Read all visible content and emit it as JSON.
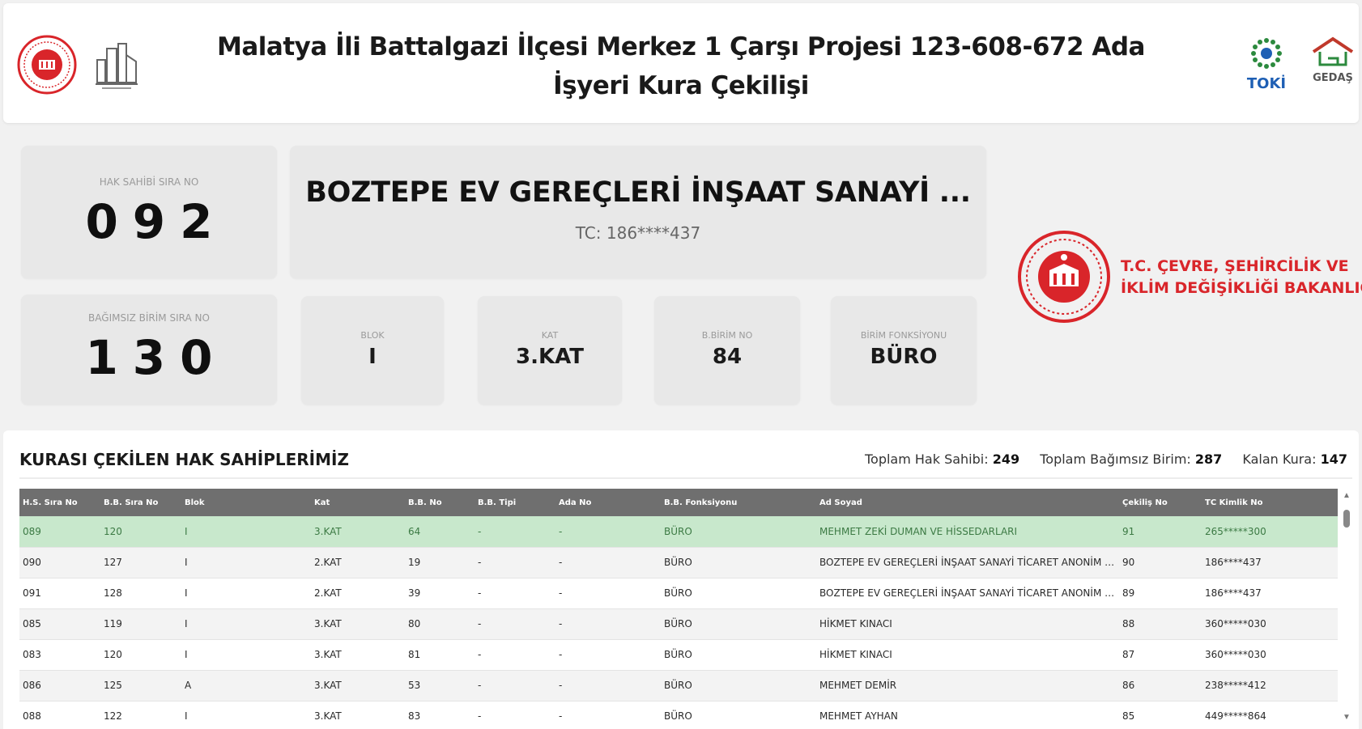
{
  "header": {
    "title": "Malatya İli Battalgazi İlçesi Merkez 1 Çarşı Projesi 123-608-672 Ada İşyeri Kura Çekilişi",
    "logo_left_1": "seal-icon",
    "logo_left_2": "building-logo-icon",
    "logo_right_1_text": "TOKİ",
    "logo_right_2_text": "GEDAŞ"
  },
  "hak_sahibi": {
    "label": "HAK SAHİBİ SIRA NO",
    "value": "092"
  },
  "bagimsiz_birim": {
    "label": "BAĞIMSIZ BİRİM SIRA NO",
    "value": "130"
  },
  "winner": {
    "name": "BOZTEPE EV GEREÇLERİ İNŞAAT SANAYİ ...",
    "tc": "TC: 186****437"
  },
  "details": [
    {
      "label": "BLOK",
      "value": "I"
    },
    {
      "label": "KAT",
      "value": "3.KAT"
    },
    {
      "label": "B.BİRİM NO",
      "value": "84"
    },
    {
      "label": "BİRİM FONKSİYONU",
      "value": "BÜRO"
    }
  ],
  "ministry": {
    "line1": "T.C. ÇEVRE, ŞEHİRCİLİK VE",
    "line2": "İKLİM DEĞİŞİKLİĞİ BAKANLIĞ"
  },
  "table_section": {
    "title": "KURASI ÇEKİLEN HAK SAHİPLERİMİZ",
    "stat1_label": "Toplam Hak Sahibi:",
    "stat1_value": "249",
    "stat2_label": "Toplam Bağımsız Birim:",
    "stat2_value": "287",
    "stat3_label": "Kalan Kura:",
    "stat3_value": "147"
  },
  "table": {
    "headers": [
      "H.S. Sıra No",
      "B.B. Sıra No",
      "Blok",
      "Kat",
      "B.B. No",
      "B.B. Tipi",
      "Ada No",
      "B.B. Fonksiyonu",
      "Ad Soyad",
      "Çekiliş No",
      "TC Kimlik No"
    ],
    "rows": [
      [
        "089",
        "120",
        "I",
        "3.KAT",
        "64",
        "-",
        "-",
        "BÜRO",
        "MEHMET ZEKİ DUMAN VE HİSSEDARLARI",
        "91",
        "265*****300"
      ],
      [
        "090",
        "127",
        "I",
        "2.KAT",
        "19",
        "-",
        "-",
        "BÜRO",
        "BOZTEPE EV GEREÇLERİ İNŞAAT SANAYİ TİCARET ANONİM Şİ...",
        "90",
        "186****437"
      ],
      [
        "091",
        "128",
        "I",
        "2.KAT",
        "39",
        "-",
        "-",
        "BÜRO",
        "BOZTEPE EV GEREÇLERİ İNŞAAT SANAYİ TİCARET ANONİM Şİ...",
        "89",
        "186****437"
      ],
      [
        "085",
        "119",
        "I",
        "3.KAT",
        "80",
        "-",
        "-",
        "BÜRO",
        "HİKMET KINACI",
        "88",
        "360*****030"
      ],
      [
        "083",
        "120",
        "I",
        "3.KAT",
        "81",
        "-",
        "-",
        "BÜRO",
        "HİKMET KINACI",
        "87",
        "360*****030"
      ],
      [
        "086",
        "125",
        "A",
        "3.KAT",
        "53",
        "-",
        "-",
        "BÜRO",
        "MEHMET DEMİR",
        "86",
        "238*****412"
      ],
      [
        "088",
        "122",
        "I",
        "3.KAT",
        "83",
        "-",
        "-",
        "BÜRO",
        "MEHMET AYHAN",
        "85",
        "449*****864"
      ]
    ]
  },
  "colors": {
    "accent_red": "#d9252a",
    "highlight_green": "#c8e8cc",
    "header_gray": "#6f6f6f",
    "toki_blue": "#1e5fb4"
  }
}
